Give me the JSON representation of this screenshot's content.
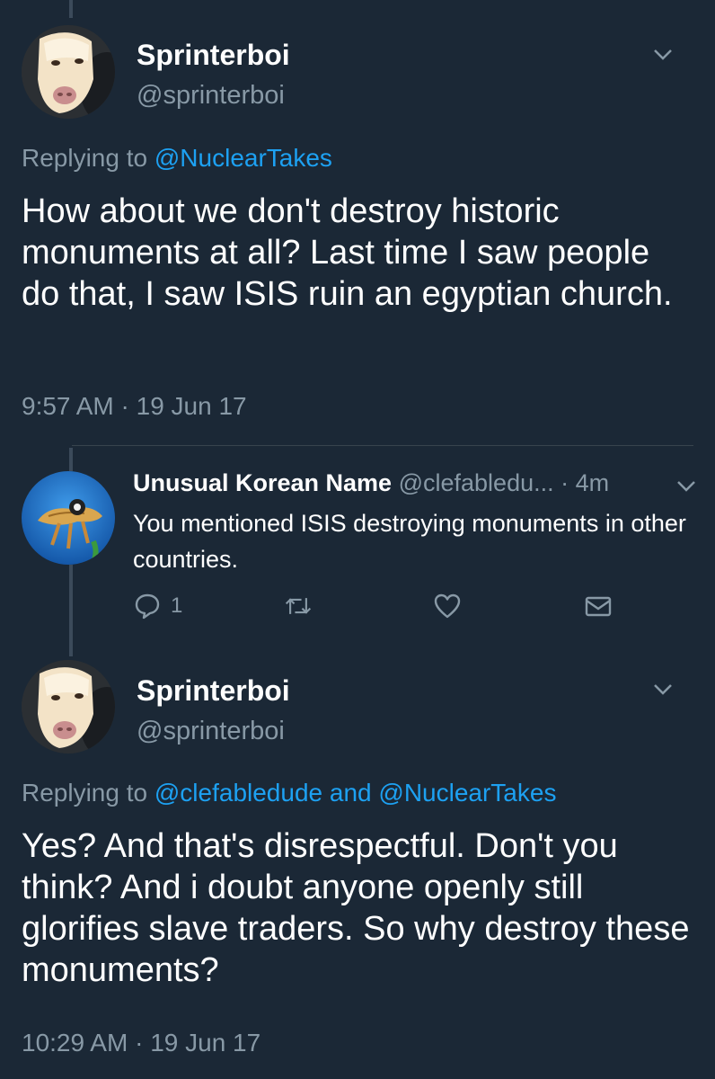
{
  "tweet1": {
    "name": "Sprinterboi",
    "handle": "@sprinterboi",
    "replying_prefix": "Replying to",
    "replying_to": "@NuclearTakes",
    "text": "How about we don't destroy historic monuments at all? Last time I saw people do that, I saw ISIS ruin an egyptian church.",
    "time": "9:57 AM",
    "date": "19 Jun 17"
  },
  "reply": {
    "name": "Unusual Korean Name",
    "handle": "@clefabledu...",
    "age": "4m",
    "text": "You mentioned ISIS destroying monuments in other countries.",
    "reply_count": "1"
  },
  "tweet2": {
    "name": "Sprinterboi",
    "handle": "@sprinterboi",
    "replying_prefix": "Replying to",
    "replying_to_a": "@clefabledude",
    "and": "and",
    "replying_to_b": "@NuclearTakes",
    "text": "Yes? And that's disrespectful. Don't you think? And i doubt anyone openly still glorifies slave traders. So why destroy these monuments?",
    "time": "10:29 AM",
    "date": "19 Jun 17"
  },
  "separator": "·",
  "icons": {
    "reply": "reply-icon",
    "retweet": "retweet-icon",
    "like": "heart-icon",
    "dm": "envelope-icon",
    "more": "chevron-down-icon"
  },
  "colors": {
    "background": "#1b2836",
    "link": "#1da1f2",
    "muted": "#8899a6"
  }
}
